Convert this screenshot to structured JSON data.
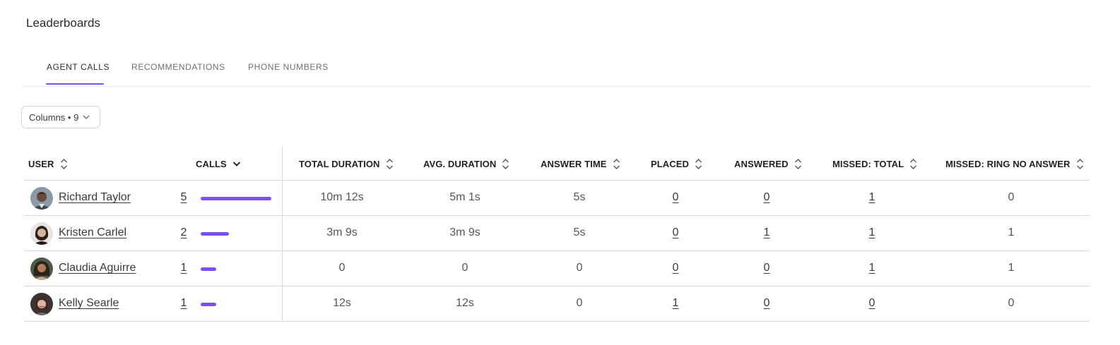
{
  "page": {
    "title": "Leaderboards"
  },
  "tabs": [
    {
      "label": "AGENT CALLS",
      "active": true
    },
    {
      "label": "RECOMMENDATIONS",
      "active": false
    },
    {
      "label": "PHONE NUMBERS",
      "active": false
    }
  ],
  "columns_button": {
    "label": "Columns • 9"
  },
  "table": {
    "headers": {
      "user": "USER",
      "calls": "CALLS",
      "total_duration": "TOTAL DURATION",
      "avg_duration": "AVG. DURATION",
      "answer_time": "ANSWER TIME",
      "placed": "PLACED",
      "answered": "ANSWERED",
      "missed_total": "MISSED: TOTAL",
      "missed_rna": "MISSED: RING NO ANSWER"
    },
    "calls_bar_color": "#7b52e8",
    "calls_max": 5,
    "rows": [
      {
        "user": "Richard Taylor",
        "calls": "5",
        "total_duration": "10m 12s",
        "avg_duration": "5m 1s",
        "answer_time": "5s",
        "placed": "0",
        "answered": "0",
        "missed_total": "1",
        "missed_rna": "0"
      },
      {
        "user": "Kristen Carlel",
        "calls": "2",
        "total_duration": "3m 9s",
        "avg_duration": "3m 9s",
        "answer_time": "5s",
        "placed": "0",
        "answered": "1",
        "missed_total": "1",
        "missed_rna": "1"
      },
      {
        "user": "Claudia Aguirre",
        "calls": "1",
        "total_duration": "0",
        "avg_duration": "0",
        "answer_time": "0",
        "placed": "0",
        "answered": "0",
        "missed_total": "1",
        "missed_rna": "1"
      },
      {
        "user": "Kelly Searle",
        "calls": "1",
        "total_duration": "12s",
        "avg_duration": "12s",
        "answer_time": "0",
        "placed": "1",
        "answered": "0",
        "missed_total": "0",
        "missed_rna": "0"
      }
    ]
  },
  "icons": {
    "sort": "sort-icon",
    "sort_active": "sort-desc-icon",
    "columns_chevron": "chevron-down-icon",
    "avatar": "avatar"
  }
}
